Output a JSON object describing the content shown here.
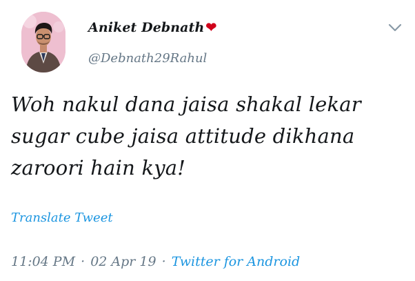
{
  "author": {
    "name": "Aniket Debnath",
    "heart": "❤",
    "handle": "@Debnath29Rahul",
    "avatar_icon": "user-avatar-photo"
  },
  "tweet": {
    "text": "Woh nakul dana jaisa shakal lekar\nsugar cube jaisa attitude dikhana\nzaroori hain kya!",
    "translate_label": "Translate Tweet"
  },
  "meta": {
    "time": "11:04 PM",
    "separator": "·",
    "date": "02 Apr 19",
    "source": "Twitter for Android"
  },
  "menu": {
    "icon": "chevron-down-icon"
  },
  "colors": {
    "text": "#14171a",
    "secondary": "#657786",
    "link": "#1b95e0",
    "heart": "#d0021b"
  }
}
